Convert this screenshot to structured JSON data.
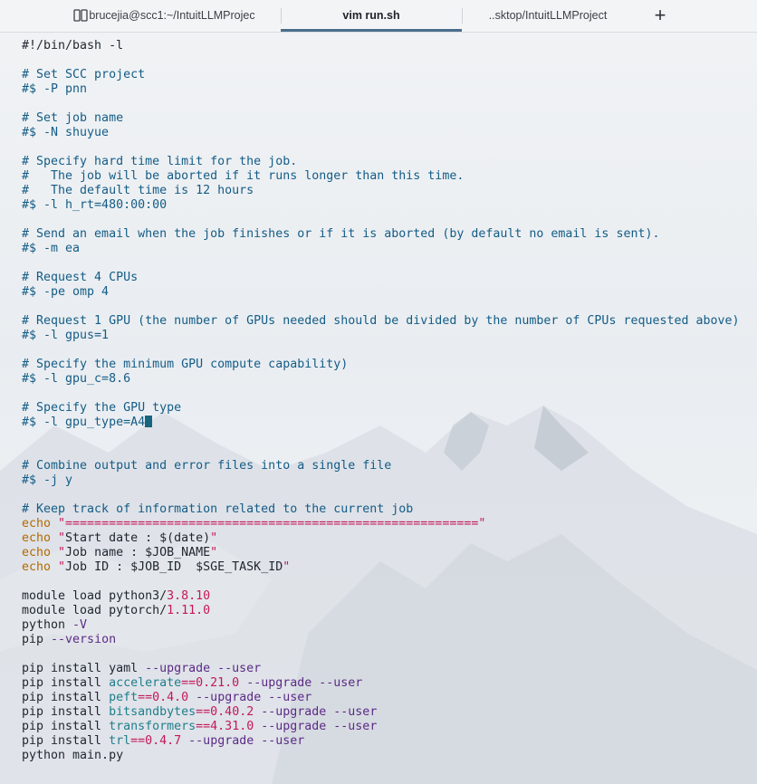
{
  "tabs": [
    {
      "label": "brucejia@scc1:~/IntuitLLMProjec",
      "active": false
    },
    {
      "label": "vim run.sh",
      "active": true
    },
    {
      "label": "..sktop/IntuitLLMProject",
      "active": false
    }
  ],
  "new_tab_symbol": "+",
  "colors": {
    "comment": "#145c86",
    "keyword": "#b26a00",
    "string": "#c2185b",
    "number": "#c2185b",
    "flag": "#5b2a86",
    "package": "#1e7f8c",
    "cursor": "#17657f"
  },
  "editor": {
    "lines": [
      [
        {
          "t": "df",
          "s": "#!/bin/bash -l"
        }
      ],
      [],
      [
        {
          "t": "cm",
          "s": "# Set SCC project"
        }
      ],
      [
        {
          "t": "cm",
          "s": "#$ -P pnn"
        }
      ],
      [],
      [
        {
          "t": "cm",
          "s": "# Set job name"
        }
      ],
      [
        {
          "t": "cm",
          "s": "#$ -N shuyue"
        }
      ],
      [],
      [
        {
          "t": "cm",
          "s": "# Specify hard time limit for the job."
        }
      ],
      [
        {
          "t": "cm",
          "s": "#   The job will be aborted if it runs longer than this time."
        }
      ],
      [
        {
          "t": "cm",
          "s": "#   The default time is 12 hours"
        }
      ],
      [
        {
          "t": "cm",
          "s": "#$ -l h_rt=480:00:00"
        }
      ],
      [],
      [
        {
          "t": "cm",
          "s": "# Send an email when the job finishes or if it is aborted (by default no email is sent)."
        }
      ],
      [
        {
          "t": "cm",
          "s": "#$ -m ea"
        }
      ],
      [],
      [
        {
          "t": "cm",
          "s": "# Request 4 CPUs"
        }
      ],
      [
        {
          "t": "cm",
          "s": "#$ -pe omp 4"
        }
      ],
      [],
      [
        {
          "t": "cm",
          "s": "# Request 1 GPU (the number of GPUs needed should be divided by the number of CPUs requested above)"
        }
      ],
      [
        {
          "t": "cm",
          "s": "#$ -l gpus=1"
        }
      ],
      [],
      [
        {
          "t": "cm",
          "s": "# Specify the minimum GPU compute capability)"
        }
      ],
      [
        {
          "t": "cm",
          "s": "#$ -l gpu_c=8.6"
        }
      ],
      [],
      [
        {
          "t": "cm",
          "s": "# Specify the GPU type"
        }
      ],
      [
        {
          "t": "cm",
          "s": "#$ -l gpu_type=A4"
        },
        {
          "t": "cursor",
          "s": ""
        }
      ],
      [],
      [],
      [
        {
          "t": "cm",
          "s": "# Combine output and error files into a single file"
        }
      ],
      [
        {
          "t": "cm",
          "s": "#$ -j y"
        }
      ],
      [],
      [
        {
          "t": "cm",
          "s": "# Keep track of information related to the current job"
        }
      ],
      [
        {
          "t": "kw",
          "s": "echo "
        },
        {
          "t": "st",
          "s": "\"=========================================================\""
        }
      ],
      [
        {
          "t": "kw",
          "s": "echo "
        },
        {
          "t": "st",
          "s": "\""
        },
        {
          "t": "df",
          "s": "Start date : $(date)"
        },
        {
          "t": "st",
          "s": "\""
        }
      ],
      [
        {
          "t": "kw",
          "s": "echo "
        },
        {
          "t": "st",
          "s": "\""
        },
        {
          "t": "df",
          "s": "Job name : $JOB_NAME"
        },
        {
          "t": "st",
          "s": "\""
        }
      ],
      [
        {
          "t": "kw",
          "s": "echo "
        },
        {
          "t": "st",
          "s": "\""
        },
        {
          "t": "df",
          "s": "Job ID : $JOB_ID  $SGE_TASK_ID"
        },
        {
          "t": "st",
          "s": "\""
        }
      ],
      [],
      [
        {
          "t": "df",
          "s": "module load python3/"
        },
        {
          "t": "nm",
          "s": "3.8.10"
        }
      ],
      [
        {
          "t": "df",
          "s": "module load pytorch/"
        },
        {
          "t": "nm",
          "s": "1.11.0"
        }
      ],
      [
        {
          "t": "df",
          "s": "python "
        },
        {
          "t": "fl",
          "s": "-V"
        }
      ],
      [
        {
          "t": "df",
          "s": "pip "
        },
        {
          "t": "fl",
          "s": "--version"
        }
      ],
      [],
      [
        {
          "t": "df",
          "s": "pip install yaml "
        },
        {
          "t": "fl",
          "s": "--upgrade --user"
        }
      ],
      [
        {
          "t": "df",
          "s": "pip install "
        },
        {
          "t": "pk",
          "s": "accelerate"
        },
        {
          "t": "st",
          "s": "=="
        },
        {
          "t": "nm",
          "s": "0.21.0"
        },
        {
          "t": "df",
          "s": " "
        },
        {
          "t": "fl",
          "s": "--upgrade --user"
        }
      ],
      [
        {
          "t": "df",
          "s": "pip install "
        },
        {
          "t": "pk",
          "s": "peft"
        },
        {
          "t": "st",
          "s": "=="
        },
        {
          "t": "nm",
          "s": "0.4.0"
        },
        {
          "t": "df",
          "s": " "
        },
        {
          "t": "fl",
          "s": "--upgrade --user"
        }
      ],
      [
        {
          "t": "df",
          "s": "pip install "
        },
        {
          "t": "pk",
          "s": "bitsandbytes"
        },
        {
          "t": "st",
          "s": "=="
        },
        {
          "t": "nm",
          "s": "0.40.2"
        },
        {
          "t": "df",
          "s": " "
        },
        {
          "t": "fl",
          "s": "--upgrade --user"
        }
      ],
      [
        {
          "t": "df",
          "s": "pip install "
        },
        {
          "t": "pk",
          "s": "transformers"
        },
        {
          "t": "st",
          "s": "=="
        },
        {
          "t": "nm",
          "s": "4.31.0"
        },
        {
          "t": "df",
          "s": " "
        },
        {
          "t": "fl",
          "s": "--upgrade --user"
        }
      ],
      [
        {
          "t": "df",
          "s": "pip install "
        },
        {
          "t": "pk",
          "s": "trl"
        },
        {
          "t": "st",
          "s": "=="
        },
        {
          "t": "nm",
          "s": "0.4.7"
        },
        {
          "t": "df",
          "s": " "
        },
        {
          "t": "fl",
          "s": "--upgrade --user"
        }
      ],
      [
        {
          "t": "df",
          "s": "python main.py"
        }
      ]
    ]
  }
}
